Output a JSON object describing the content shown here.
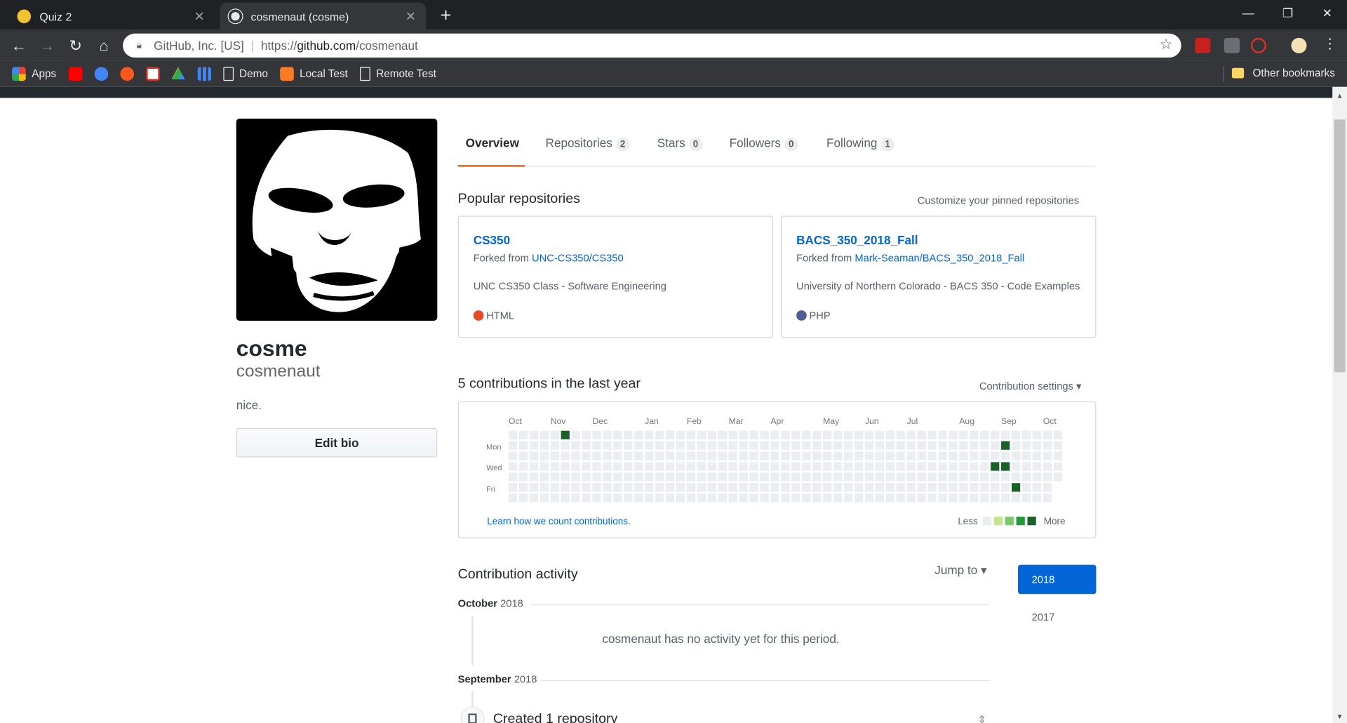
{
  "browser": {
    "tabs": [
      {
        "title": "Quiz 2",
        "active": false
      },
      {
        "title": "cosmenaut (cosme)",
        "active": true
      }
    ],
    "new_tab": "+",
    "window_controls": {
      "minimize": "—",
      "restore": "❐",
      "close": "✕"
    },
    "omnibox": {
      "org": "GitHub, Inc. [US]",
      "url_prefix": "https://",
      "url_host": "github.com",
      "url_path": "/cosmenaut"
    },
    "bookmarks": [
      {
        "label": "Apps",
        "icon": "apps-grid-icon",
        "color": "#ea4335"
      },
      {
        "label": "",
        "icon": "adobe-icon",
        "color": "#ff0000"
      },
      {
        "label": "",
        "icon": "blue-circle-icon",
        "color": "#4285f4"
      },
      {
        "label": "",
        "icon": "music-icon",
        "color": "#fa5a1e"
      },
      {
        "label": "",
        "icon": "gmail-icon",
        "color": "#d93025"
      },
      {
        "label": "",
        "icon": "drive-icon",
        "color": "#34a853"
      },
      {
        "label": "",
        "icon": "grid-icon",
        "color": "#4285f4"
      },
      {
        "label": "Demo",
        "icon": "page-icon",
        "color": "#e8eaed"
      },
      {
        "label": "Local Test",
        "icon": "xampp-icon",
        "color": "#fb7a24"
      },
      {
        "label": "Remote Test",
        "icon": "page-icon",
        "color": "#e8eaed"
      }
    ],
    "other_bookmarks": "Other bookmarks"
  },
  "profile": {
    "fullname": "cosme",
    "username": "cosmenaut",
    "bio": "nice.",
    "edit_bio": "Edit bio"
  },
  "nav": {
    "overview": "Overview",
    "repositories": {
      "label": "Repositories",
      "count": "2"
    },
    "stars": {
      "label": "Stars",
      "count": "0"
    },
    "followers": {
      "label": "Followers",
      "count": "0"
    },
    "following": {
      "label": "Following",
      "count": "1"
    }
  },
  "popular": {
    "title": "Popular repositories",
    "customize": "Customize your pinned repositories",
    "repos": [
      {
        "name": "CS350",
        "forked_prefix": "Forked from ",
        "forked_from": "UNC-CS350/CS350",
        "description": "UNC CS350 Class - Software Engineering",
        "language": "HTML",
        "lang_color": "#e34c26"
      },
      {
        "name": "BACS_350_2018_Fall",
        "forked_prefix": "Forked from ",
        "forked_from": "Mark-Seaman/BACS_350_2018_Fall",
        "description": "University of Northern Colorado - BACS 350 - Code Examples",
        "language": "PHP",
        "lang_color": "#4F5D95"
      }
    ]
  },
  "contributions": {
    "title": "5 contributions in the last year",
    "settings": "Contribution settings ▾",
    "months": [
      "Oct",
      "Nov",
      "Dec",
      "Jan",
      "Feb",
      "Mar",
      "Apr",
      "May",
      "Jun",
      "Jul",
      "Aug",
      "Sep",
      "Oct"
    ],
    "days": [
      "Mon",
      "Wed",
      "Fri"
    ],
    "learn": "Learn how we count contributions.",
    "less": "Less",
    "more": "More",
    "legend_colors": [
      "#ebedf0",
      "#c6e48b",
      "#7bc96f",
      "#239a3b",
      "#196127"
    ],
    "empty_color": "#ebedf0",
    "active_color": "#196127",
    "weeks": 53,
    "last_week_days": 5,
    "active_cells": [
      [
        5,
        0
      ],
      [
        47,
        1
      ],
      [
        46,
        3
      ],
      [
        47,
        3
      ],
      [
        48,
        5
      ]
    ]
  },
  "activity": {
    "title": "Contribution activity",
    "jump": "Jump to ▾",
    "years": [
      "2018",
      "2017"
    ],
    "periods": [
      {
        "month": "October",
        "year": "2018",
        "text": "cosmenaut has no activity yet for this period."
      },
      {
        "month": "September",
        "year": "2018"
      }
    ],
    "created": "Created 1 repository"
  }
}
